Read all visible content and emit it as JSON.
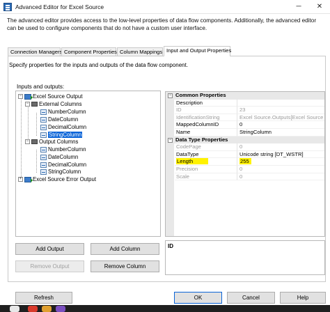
{
  "window": {
    "title": "Advanced Editor for Excel Source",
    "minimize": "─",
    "close": "✕"
  },
  "description": "The advanced editor provides access to the low-level properties of data flow components. Additionally, the advanced editor can be used to configure components that do not have a custom user interface.",
  "tabs": [
    {
      "label": "Connection Managers"
    },
    {
      "label": "Component Properties"
    },
    {
      "label": "Column Mappings"
    },
    {
      "label": "Input and Output Properties"
    }
  ],
  "panel": {
    "description": "Specify properties for the inputs and outputs of the data flow component.",
    "io_label": "Inputs and outputs:"
  },
  "tree": {
    "output": "Excel Source Output",
    "external_columns": "External Columns",
    "external": [
      "NumberColumn",
      "DateColumn",
      "DecimalColumn",
      "StringColumn"
    ],
    "output_columns": "Output Columns",
    "outputs": [
      "NumberColumn",
      "DateColumn",
      "DecimalColumn",
      "StringColumn"
    ],
    "error_output": "Excel Source Error Output"
  },
  "buttons": {
    "add_output": "Add Output",
    "add_column": "Add Column",
    "remove_output": "Remove Output",
    "remove_column": "Remove Column",
    "refresh": "Refresh",
    "ok": "OK",
    "cancel": "Cancel",
    "help": "Help"
  },
  "properties": {
    "common_header": "Common Properties",
    "common": [
      {
        "name": "Description",
        "value": "",
        "readonly": false
      },
      {
        "name": "ID",
        "value": "23",
        "readonly": true
      },
      {
        "name": "IdentificationString",
        "value": "Excel Source.Outputs[Excel Source",
        "readonly": true
      },
      {
        "name": "MappedColumnID",
        "value": "0",
        "readonly": false
      },
      {
        "name": "Name",
        "value": "StringColumn",
        "readonly": false
      }
    ],
    "datatype_header": "Data Type Properties",
    "datatype": [
      {
        "name": "CodePage",
        "value": "0",
        "readonly": true
      },
      {
        "name": "DataType",
        "value": "Unicode string [DT_WSTR]",
        "readonly": false
      },
      {
        "name": "Length",
        "value": "255",
        "readonly": false
      },
      {
        "name": "Precision",
        "value": "0",
        "readonly": true
      },
      {
        "name": "Scale",
        "value": "0",
        "readonly": true
      }
    ]
  },
  "description_pane": {
    "title": "ID"
  },
  "colors": {
    "highlight": "#fff200",
    "selection": "#0a64d8"
  }
}
